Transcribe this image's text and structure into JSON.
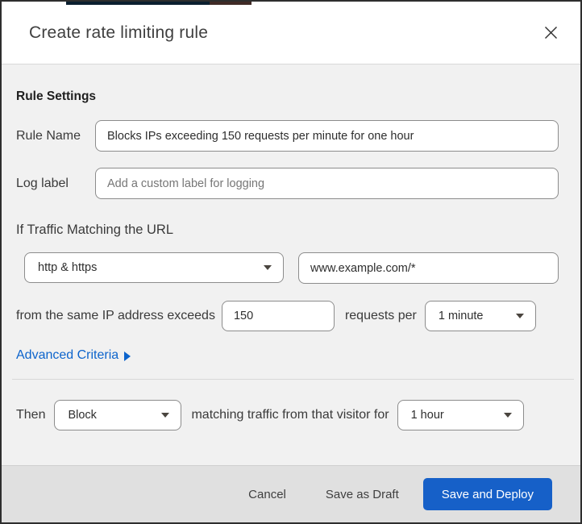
{
  "modal": {
    "title": "Create rate limiting rule"
  },
  "form": {
    "section_heading": "Rule Settings",
    "rule_name": {
      "label": "Rule Name",
      "value": "Blocks IPs exceeding 150 requests per minute for one hour"
    },
    "log_label": {
      "label": "Log label",
      "placeholder": "Add a custom label for logging"
    },
    "traffic_match": {
      "intro": "If Traffic Matching the URL",
      "scheme_select": {
        "value": "http & https"
      },
      "url_input": {
        "value": "www.example.com/*"
      },
      "exceeds_text": "from the same IP address exceeds",
      "requests_value": "150",
      "requests_per_text": "requests per",
      "period_select": {
        "value": "1 minute"
      }
    },
    "advanced_criteria_label": "Advanced Criteria",
    "then": {
      "label": "Then",
      "action_select": {
        "value": "Block"
      },
      "middle_text": "matching traffic from that visitor for",
      "duration_select": {
        "value": "1 hour"
      }
    }
  },
  "footer": {
    "cancel_label": "Cancel",
    "save_draft_label": "Save as Draft",
    "save_deploy_label": "Save and Deploy"
  },
  "icons": {
    "close": "x-icon",
    "select_caret": "caret-down-icon",
    "advanced_arrow": "caret-right-icon"
  },
  "colors": {
    "link_blue": "#0d64cc",
    "primary_button_blue": "#1660c8",
    "body_background": "#f1f1f1",
    "footer_background": "#e0e0e0",
    "input_border": "#8c8c8c",
    "top_strip_navy": "#0c2030",
    "top_strip_red": "#402a26"
  }
}
